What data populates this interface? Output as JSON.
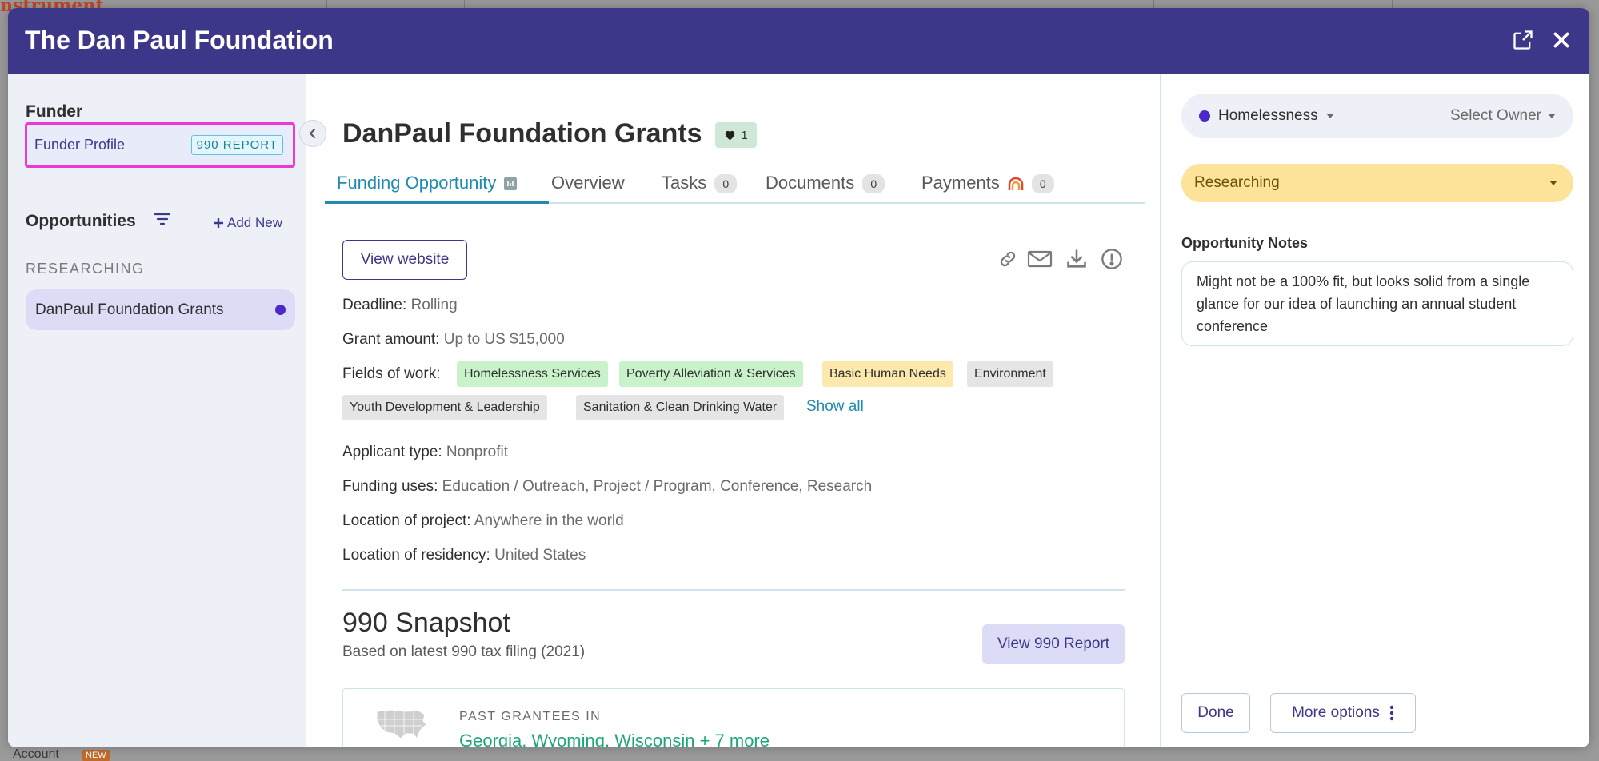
{
  "modal": {
    "title": "The Dan Paul Foundation"
  },
  "sidebar": {
    "funder_heading": "Funder",
    "funder_profile_label": "Funder Profile",
    "report_badge": "990 REPORT",
    "opportunities_heading": "Opportunities",
    "add_new_label": "Add New",
    "stage_label": "RESEARCHING",
    "items": [
      {
        "label": "DanPaul Foundation Grants"
      }
    ]
  },
  "main": {
    "title": "DanPaul Foundation Grants",
    "likes": "1",
    "tabs": [
      {
        "label": "Funding Opportunity"
      },
      {
        "label": "Overview"
      },
      {
        "label": "Tasks",
        "count": "0"
      },
      {
        "label": "Documents",
        "count": "0"
      },
      {
        "label": "Payments",
        "count": "0"
      }
    ],
    "view_website_label": "View website",
    "fields": {
      "deadline_label": "Deadline:",
      "deadline_value": "Rolling",
      "grant_amount_label": "Grant amount:",
      "grant_amount_value": "Up to US $15,000",
      "fields_of_work_label": "Fields of work:",
      "applicant_type_label": "Applicant type:",
      "applicant_type_value": "Nonprofit",
      "funding_uses_label": "Funding uses:",
      "funding_uses_value": "Education / Outreach, Project / Program, Conference, Research",
      "location_project_label": "Location of project:",
      "location_project_value": "Anywhere in the world",
      "location_residency_label": "Location of residency:",
      "location_residency_value": "United States"
    },
    "tags": [
      "Homelessness Services",
      "Poverty Alleviation & Services",
      "Basic Human Needs",
      "Environment",
      "Youth Development & Leadership",
      "Sanitation & Clean Drinking Water"
    ],
    "show_all_label": "Show all",
    "snapshot": {
      "title": "990 Snapshot",
      "subtitle": "Based on latest 990 tax filing (2021)",
      "view_report_label": "View 990 Report",
      "past_grantees_label": "PAST GRANTEES IN",
      "past_grantees_states": "Georgia, Wyoming, Wisconsin + 7 more"
    }
  },
  "right_panel": {
    "category": "Homelessness",
    "owner_placeholder": "Select Owner",
    "status": "Researching",
    "notes_label": "Opportunity Notes",
    "notes_text": "Might not be a 100% fit, but looks solid from a single glance for our idea of launching an annual student conference",
    "done_label": "Done",
    "more_options_label": "More options"
  },
  "background": {
    "account_label": "Account",
    "new_badge": "NEW"
  },
  "colors": {
    "header": "#3d3789",
    "accent_teal": "#1f8bb0",
    "category_dot": "#4a29c8",
    "status_yellow": "#fde29a",
    "highlight_pink": "#e73ad7",
    "link_green": "#1ca57a"
  }
}
